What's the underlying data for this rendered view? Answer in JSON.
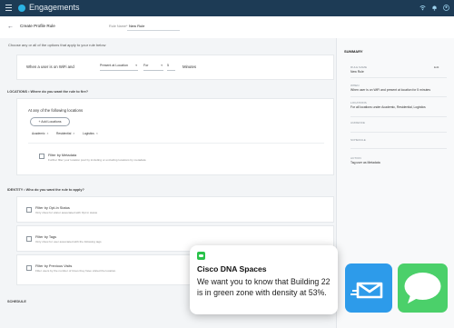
{
  "app": {
    "title": "Engagements"
  },
  "header": {
    "page_title": "Create Profile Rule",
    "name_label": "Rule Name*",
    "name_value": "New Rule"
  },
  "intro": "Choose any or all of the options that apply to your rule below",
  "trigger": {
    "prefix": "When a user is on WiFi and",
    "presence": "Present at Location",
    "comparator": "For",
    "amount": "5",
    "unit": "Minutes"
  },
  "locations": {
    "section_label": "LOCATIONS • Where do you want the rule to fire?",
    "any_text": "At any of the following locations",
    "add_button": "+ Add Locations",
    "chips": [
      "Academic",
      "Residential",
      "Logistics"
    ],
    "metadata_title": "Filter by Metadata",
    "metadata_sub": "Further filter your location pool by including or excluding locations by metadata"
  },
  "identity": {
    "section_label": "IDENTITY • Who do you want the rule to apply?",
    "options": [
      {
        "title": "Filter by Opt-In Status",
        "sub": "Only show for visitor associated with Opt in status"
      },
      {
        "title": "Filter by Tags",
        "sub": "Only show for user associated with the following tags"
      },
      {
        "title": "Filter by Previous Visits",
        "sub": "Filter users by the number of times they have visited the location."
      }
    ]
  },
  "schedule": {
    "section_label": "SCHEDULE"
  },
  "summary": {
    "title": "SUMMARY",
    "edit": "Edit",
    "rule_name_label": "RULE NAME",
    "rule_name_value": "New Rule",
    "when_label": "WHEN",
    "when_value": "When user is on WiFi and present at location for 5 minutes",
    "locations_label": "LOCATIONS",
    "locations_value": "For all locations under Academic, Residential, Logistics",
    "audience_label": "AUDIENCE",
    "schedule_label": "SCHEDULE",
    "action_label": "ACTION",
    "action_value": "Tag user as Metadata"
  },
  "notification": {
    "title": "Cisco DNA Spaces",
    "body": "We want you to know that Building 22 is in green zone with density at 53%."
  },
  "colors": {
    "topbar": "#1d3b55",
    "accent": "#2bb2e3",
    "mail_tile": "#2d9bea",
    "messages_tile": "#4bd06a"
  },
  "icons": [
    "menu-icon",
    "brand-icon",
    "wifi-icon",
    "bell-icon",
    "user-icon",
    "back-arrow-icon",
    "mail-app-icon",
    "messages-app-icon"
  ]
}
